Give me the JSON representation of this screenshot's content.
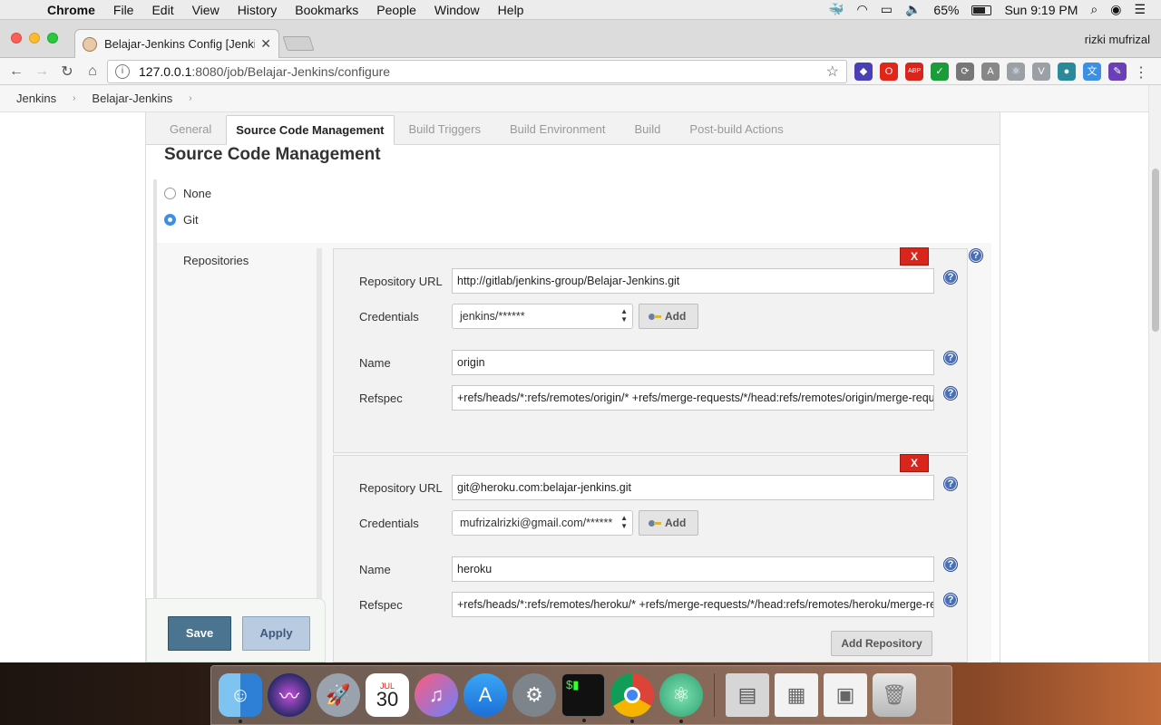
{
  "menubar": {
    "app": "Chrome",
    "items": [
      "File",
      "Edit",
      "View",
      "History",
      "Bookmarks",
      "People",
      "Window",
      "Help"
    ],
    "battery": "65%",
    "clock": "Sun 9:19 PM"
  },
  "browser": {
    "tab_title": "Belajar-Jenkins Config [Jenkins]",
    "profile": "rizki mufrizal",
    "url_host": "127.0.0.1",
    "url_rest": ":8080/job/Belajar-Jenkins/configure",
    "extensions": [
      {
        "name": "layers-extension-icon",
        "color": "#4b3fb5",
        "glyph": "◆"
      },
      {
        "name": "opera-extension-icon",
        "color": "#e0261b",
        "glyph": "O"
      },
      {
        "name": "adblock-plus-icon",
        "color": "#d9261c",
        "glyph": "ABP"
      },
      {
        "name": "check-extension-icon",
        "color": "#1c9b3a",
        "glyph": "✓"
      },
      {
        "name": "sync-extension-icon",
        "color": "#777777",
        "glyph": "⟳"
      },
      {
        "name": "angular-extension-icon",
        "color": "#888888",
        "glyph": "A"
      },
      {
        "name": "react-extension-icon",
        "color": "#9aa0a6",
        "glyph": "⚛"
      },
      {
        "name": "vue-extension-icon",
        "color": "#9aa0a6",
        "glyph": "V"
      },
      {
        "name": "dot-extension-icon",
        "color": "#2a8a9a",
        "glyph": "●"
      },
      {
        "name": "translate-extension-icon",
        "color": "#3d8fe6",
        "glyph": "文"
      },
      {
        "name": "pen-extension-icon",
        "color": "#6b3fb5",
        "glyph": "✎"
      }
    ]
  },
  "breadcrumbs": [
    "Jenkins",
    "Belajar-Jenkins"
  ],
  "config": {
    "tabs": [
      "General",
      "Source Code Management",
      "Build Triggers",
      "Build Environment",
      "Build",
      "Post-build Actions"
    ],
    "active_tab": "Source Code Management",
    "section_title": "Source Code Management",
    "scm_options": [
      {
        "label": "None",
        "checked": false
      },
      {
        "label": "Git",
        "checked": true
      }
    ],
    "repositories_label": "Repositories",
    "labels": {
      "repo_url": "Repository URL",
      "credentials": "Credentials",
      "name": "Name",
      "refspec": "Refspec",
      "add": "Add",
      "delete": "X"
    },
    "repositories": [
      {
        "url": "http://gitlab/jenkins-group/Belajar-Jenkins.git",
        "credentials": "jenkins/******",
        "name": "origin",
        "refspec": "+refs/heads/*:refs/remotes/origin/* +refs/merge-requests/*/head:refs/remotes/origin/merge-requests/*"
      },
      {
        "url": "git@heroku.com:belajar-jenkins.git",
        "credentials": "mufrizalrizki@gmail.com/******",
        "name": "heroku",
        "refspec": "+refs/heads/*:refs/remotes/heroku/* +refs/merge-requests/*/head:refs/remotes/heroku/merge-requests/*"
      }
    ],
    "add_repository": "Add Repository",
    "save": "Save",
    "apply": "Apply"
  },
  "dock": {
    "calendar_month": "JUL",
    "calendar_day": "30",
    "apps": [
      "finder",
      "siri",
      "launchpad",
      "calendar",
      "itunes",
      "app-store",
      "system-preferences",
      "terminal",
      "chrome",
      "atom"
    ]
  }
}
